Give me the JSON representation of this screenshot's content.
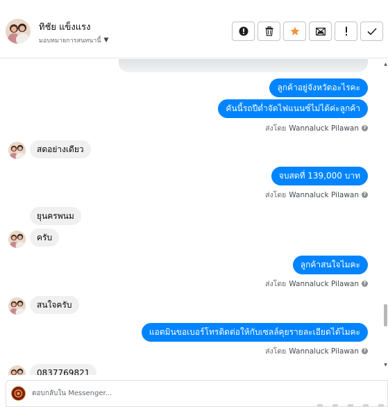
{
  "header": {
    "name": "ทิชัย แข็งแรง",
    "status": "มอบหมายการสนทนานี้"
  },
  "toolbar": {
    "actions": [
      {
        "icon": "alert-circle-icon"
      },
      {
        "icon": "trash-icon"
      },
      {
        "icon": "star-icon"
      },
      {
        "icon": "mail-block-icon"
      },
      {
        "icon": "exclamation-icon"
      },
      {
        "icon": "check-icon"
      }
    ]
  },
  "thread": {
    "messages": [
      {
        "side": "out",
        "text": "ลูกค้าอยู่จังหวัดอะไรคะ"
      },
      {
        "side": "out",
        "text": "คันนี้รถปีต่ำจัดไฟแนนซ์ไม่ได้ค่ะลูกค้า"
      },
      {
        "side": "in",
        "text": "สดอย่างเดียว"
      },
      {
        "side": "out",
        "text": "จบสดที่ 139,000 บาท"
      },
      {
        "side": "in",
        "text": "ยุนครพนม"
      },
      {
        "side": "in",
        "text": "ครับ"
      },
      {
        "side": "out",
        "text": "ลูกค้าสนใจไมคะ"
      },
      {
        "side": "in",
        "text": "สนใจครับ"
      },
      {
        "side": "out",
        "text": "แอดมินขอเบอร์โทรติดต่อให้กับเซลล์คุยรายละเอียดได้ไมคะ"
      },
      {
        "side": "in",
        "text": "0837769821"
      }
    ],
    "sent_by_prefix": "ส่งโดย",
    "sent_by_name": "Wannaluck Pilawan"
  },
  "composer": {
    "placeholder": "ตอบกลับใน Messenger..."
  },
  "colors": {
    "accent": "#0084ff",
    "incoming_bubble": "#f0f0f0",
    "star": "#f7923b"
  }
}
